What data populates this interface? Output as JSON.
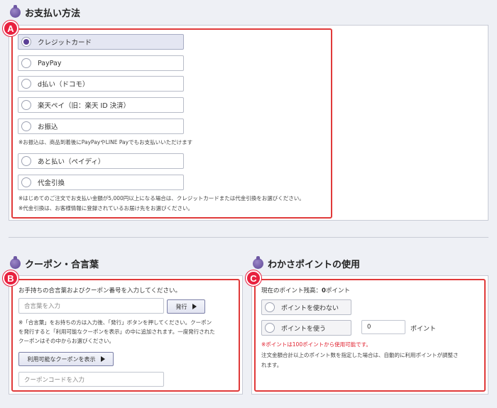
{
  "payment": {
    "title": "お支払い方法",
    "marker": "A",
    "options": [
      {
        "label": "クレジットカード",
        "selected": true
      },
      {
        "label": "PayPay",
        "selected": false
      },
      {
        "label": "d払い（ドコモ）",
        "selected": false
      },
      {
        "label": "楽天ペイ（旧：楽天 ID 決済）",
        "selected": false
      },
      {
        "label": "お振込",
        "selected": false
      },
      {
        "label": "あと払い（ペイディ）",
        "selected": false
      },
      {
        "label": "代金引換",
        "selected": false
      }
    ],
    "note_transfer": "※お振込は、商品到着後にPayPayやLINE Payでもお支払いいただけます",
    "note_first": "※はじめてのご注文でお支払い金額が5,000円以上になる場合は、クレジットカードまたは代金引換をお選びください。",
    "note_cod": "※代金引換は、お客様情報に登録されているお届け先をお選びください。"
  },
  "coupon": {
    "title": "クーポン・合言葉",
    "marker": "B",
    "instruction": "お手持ちの合言葉およびクーポン番号を入力してください。",
    "aikotoba_placeholder": "合言葉を入力",
    "issue_button": "発行",
    "note_line1": "※「合言葉」をお持ちの方は入力後、「発行」ボタンを押してください。クーポン",
    "note_line2": "を発行すると「利用可能なクーポンを表示」の中に追加されます。一度発行された",
    "note_line3": "クーポンはその中からお選びください。",
    "show_coupons_button": "利用可能なクーポンを表示",
    "code_placeholder": "クーポンコードを入力"
  },
  "points": {
    "title": "わかさポイントの使用",
    "marker": "C",
    "balance_label": "現在のポイント残高：",
    "balance_value": "0",
    "balance_unit": "ポイント",
    "option_no": "ポイントを使わない",
    "option_yes": "ポイントを使う",
    "input_value": "0",
    "input_unit": "ポイント",
    "warning": "※ポイントは100ポイントから使用可能です。",
    "note_line1": "注文金額合計以上のポイント数を指定した場合は、自動的に利用ポイントが調整さ",
    "note_line2": "れます。"
  },
  "colors": {
    "accent": "#5b3f95",
    "highlight": "#e03a3a",
    "marker": "#e8213f"
  }
}
